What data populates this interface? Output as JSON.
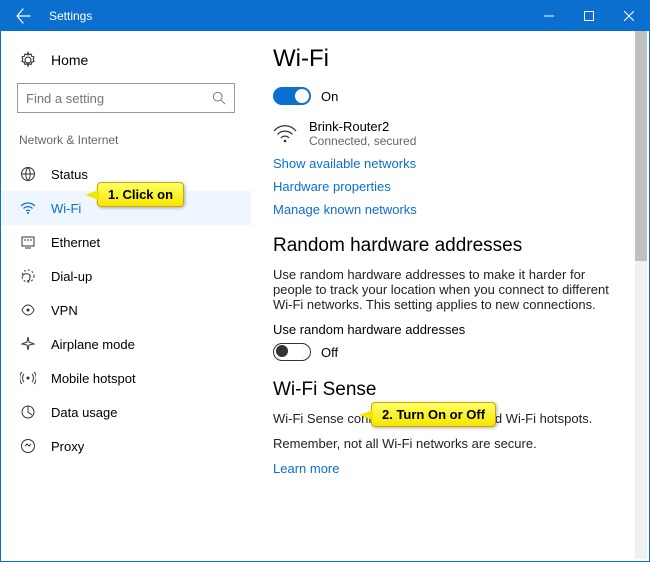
{
  "window": {
    "title": "Settings"
  },
  "sidebar": {
    "home": "Home",
    "search_placeholder": "Find a setting",
    "section": "Network & Internet",
    "items": [
      {
        "label": "Status"
      },
      {
        "label": "Wi-Fi"
      },
      {
        "label": "Ethernet"
      },
      {
        "label": "Dial-up"
      },
      {
        "label": "VPN"
      },
      {
        "label": "Airplane mode"
      },
      {
        "label": "Mobile hotspot"
      },
      {
        "label": "Data usage"
      },
      {
        "label": "Proxy"
      }
    ]
  },
  "content": {
    "page_title": "Wi-Fi",
    "wifi_toggle_text": "On",
    "network_name": "Brink-Router2",
    "network_status": "Connected, secured",
    "link_show": "Show available networks",
    "link_hw": "Hardware properties",
    "link_manage": "Manage known networks",
    "rha_title": "Random hardware addresses",
    "rha_desc": "Use random hardware addresses to make it harder for people to track your location when you connect to different Wi-Fi networks. This setting applies to new connections.",
    "rha_label": "Use random hardware addresses",
    "rha_toggle_text": "Off",
    "ws_title": "Wi-Fi Sense",
    "ws_line1": "Wi-Fi Sense connects you to suggested Wi-Fi hotspots.",
    "ws_line2": "Remember, not all Wi-Fi networks are secure.",
    "ws_learn": "Learn more"
  },
  "callouts": {
    "c1": "1. Click on",
    "c2": "2. Turn On or Off"
  }
}
